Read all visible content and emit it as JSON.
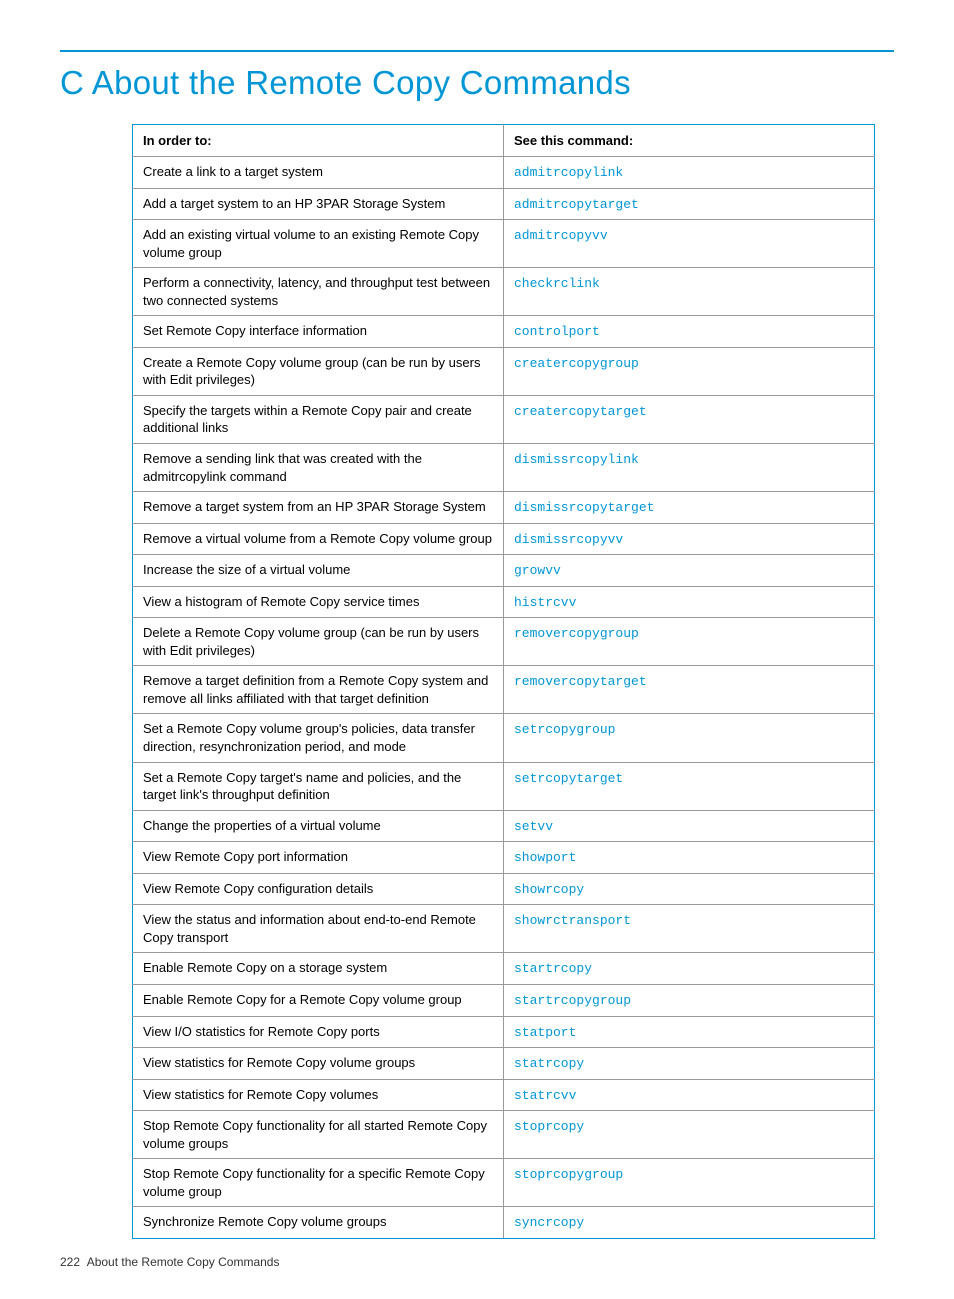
{
  "title": "C About the Remote Copy Commands",
  "headers": {
    "col1": "In order to:",
    "col2": "See this command:"
  },
  "rows": [
    {
      "desc": "Create a link to a target system",
      "cmd": "admitrcopylink"
    },
    {
      "desc": "Add a target system to an HP 3PAR Storage System",
      "cmd": "admitrcopytarget"
    },
    {
      "desc": "Add an existing virtual volume to an existing Remote Copy volume group",
      "cmd": "admitrcopyvv"
    },
    {
      "desc": "Perform a connectivity, latency, and throughput test between two connected systems",
      "cmd": "checkrclink"
    },
    {
      "desc": "Set Remote Copy interface information",
      "cmd": "controlport"
    },
    {
      "desc": "Create a Remote Copy volume group (can be run by users with Edit privileges)",
      "cmd": "creatercopygroup"
    },
    {
      "desc": "Specify the targets within a Remote Copy pair and create additional links",
      "cmd": "creatercopytarget"
    },
    {
      "desc": "Remove a sending link that was created with the admitrcopylink command",
      "cmd": "dismissrcopylink"
    },
    {
      "desc": "Remove a target system from an HP 3PAR Storage System",
      "cmd": "dismissrcopytarget"
    },
    {
      "desc": "Remove a virtual volume from a Remote Copy volume group",
      "cmd": "dismissrcopyvv"
    },
    {
      "desc": "Increase the size of a virtual volume",
      "cmd": "growvv"
    },
    {
      "desc": "View a histogram of Remote Copy service times",
      "cmd": "histrcvv"
    },
    {
      "desc": "Delete a Remote Copy volume group (can be run by users with Edit privileges)",
      "cmd": "removercopygroup"
    },
    {
      "desc": "Remove a target definition from a Remote Copy system and remove all links affiliated with that target definition",
      "cmd": "removercopytarget"
    },
    {
      "desc": "Set a Remote Copy volume group's policies, data transfer direction, resynchronization period, and mode",
      "cmd": "setrcopygroup"
    },
    {
      "desc": "Set a Remote Copy target's name and policies, and the target link's throughput definition",
      "cmd": "setrcopytarget"
    },
    {
      "desc": "Change the properties of a virtual volume",
      "cmd": "setvv"
    },
    {
      "desc": "View Remote Copy port information",
      "cmd": "showport"
    },
    {
      "desc": "View Remote Copy configuration details",
      "cmd": "showrcopy"
    },
    {
      "desc": "View the status and information about end-to-end Remote Copy transport",
      "cmd": "showrctransport"
    },
    {
      "desc": "Enable Remote Copy on a storage system",
      "cmd": "startrcopy"
    },
    {
      "desc": "Enable Remote Copy for a Remote Copy volume group",
      "cmd": "startrcopygroup"
    },
    {
      "desc": "View I/O statistics for Remote Copy ports",
      "cmd": "statport"
    },
    {
      "desc": "View statistics for Remote Copy volume groups",
      "cmd": "statrcopy"
    },
    {
      "desc": "View statistics for Remote Copy volumes",
      "cmd": "statrcvv"
    },
    {
      "desc": "Stop Remote Copy functionality for all started Remote Copy volume groups",
      "cmd": "stoprcopy"
    },
    {
      "desc": "Stop Remote Copy functionality for a specific Remote Copy volume group",
      "cmd": "stoprcopygroup"
    },
    {
      "desc": "Synchronize Remote Copy volume groups",
      "cmd": "syncrcopy"
    }
  ],
  "footer": {
    "page": "222",
    "section": "About the Remote Copy Commands"
  }
}
